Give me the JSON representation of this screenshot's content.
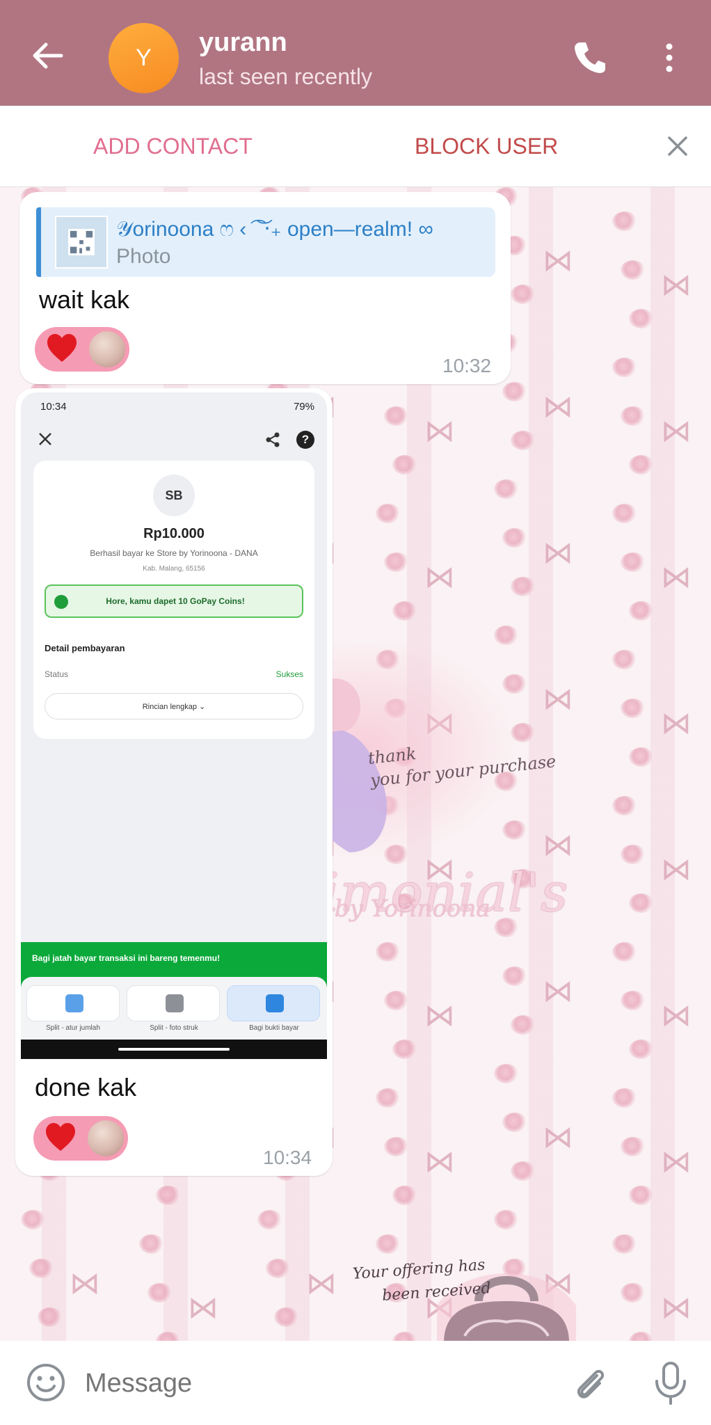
{
  "header": {
    "title": "yurann",
    "subtitle": "last seen recently",
    "avatar_letter": "Y",
    "accent_color": "#b17582",
    "icons": [
      "back-arrow-icon",
      "phone-icon",
      "more-vert-icon"
    ]
  },
  "action_bar": {
    "add_contact": "ADD CONTACT",
    "block_user": "BLOCK USER"
  },
  "messages": [
    {
      "reply": {
        "name": "𝒴orinoona ෆ ‹ ͡ ͝ ‧₊ open—realm! ∞",
        "type": "Photo"
      },
      "text": "wait kak",
      "reaction": "❤",
      "time": "10:32"
    },
    {
      "text": "done kak",
      "reaction": "❤",
      "time": "10:34",
      "screenshot": {
        "time": "10:34",
        "battery": "79%",
        "logo": "SB",
        "amount": "Rp10.000",
        "desc": "Berhasil bayar ke Store by Yorinoona - DANA",
        "location": "Kab. Malang, 65156",
        "coins": "Hore, kamu dapet 10 GoPay Coins!",
        "detail_title": "Detail pembayaran",
        "status_label": "Status",
        "status_value": "Sukses",
        "rincian": "Rincian lengkap ⌄",
        "banner": "Bagi jatah bayar transaksi ini bareng temenmu!",
        "options": [
          "Split - atur jumlah",
          "Split - foto struk",
          "Bagi bukti bayar"
        ]
      }
    }
  ],
  "stickers": {
    "thanks": [
      "thank",
      "you for your purchase"
    ],
    "title": "Testimonial's",
    "store": "store by Yorinoona",
    "offering": [
      "Your offering has",
      "been received"
    ]
  },
  "input": {
    "placeholder": "Message"
  }
}
